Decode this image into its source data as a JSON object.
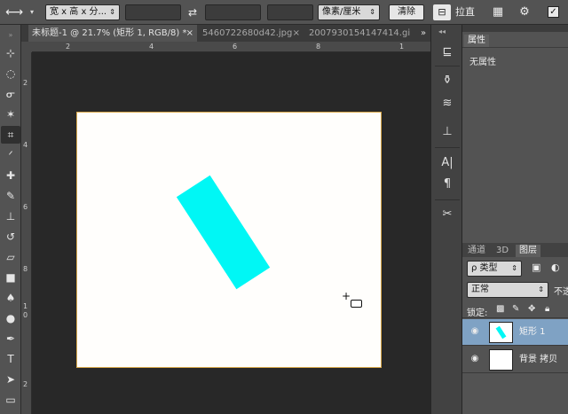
{
  "options_bar": {
    "ratio_dropdown": "宽 x 高 x 分...",
    "units_dropdown": "像素/厘米",
    "clear_button": "清除",
    "straighten_label": "拉直"
  },
  "document_tabs": [
    {
      "label": "未标题-1 @ 21.7% (矩形 1, RGB/8) *",
      "close": "×",
      "active": true
    },
    {
      "label": "5460722680d42.jpg",
      "close": "×",
      "active": false
    },
    {
      "label": "20079301541474​14.gi",
      "close": "",
      "active": false
    }
  ],
  "tabs_overflow": "»",
  "rulers": {
    "h_labels": [
      "2",
      "4",
      "6",
      "8",
      "1"
    ],
    "v_labels": [
      "2",
      "4",
      "6",
      "8",
      "1",
      "0",
      "2"
    ]
  },
  "colors": {
    "shape_fill": "#00f7f5",
    "document_bg": "#fffefc",
    "selected_layer": "#7fa2c4"
  },
  "properties_panel": {
    "tab": "属性",
    "no_properties": "无属性"
  },
  "layers_panel": {
    "tabs": [
      "通道",
      "3D",
      "图层"
    ],
    "filter_dropdown": "ρ 类型",
    "blend_mode": "正常",
    "opacity_label": "不透",
    "lock_label": "锁定:",
    "layers": [
      {
        "name": "矩形 1",
        "selected": true
      },
      {
        "name": "背景 拷贝",
        "selected": false
      }
    ]
  }
}
